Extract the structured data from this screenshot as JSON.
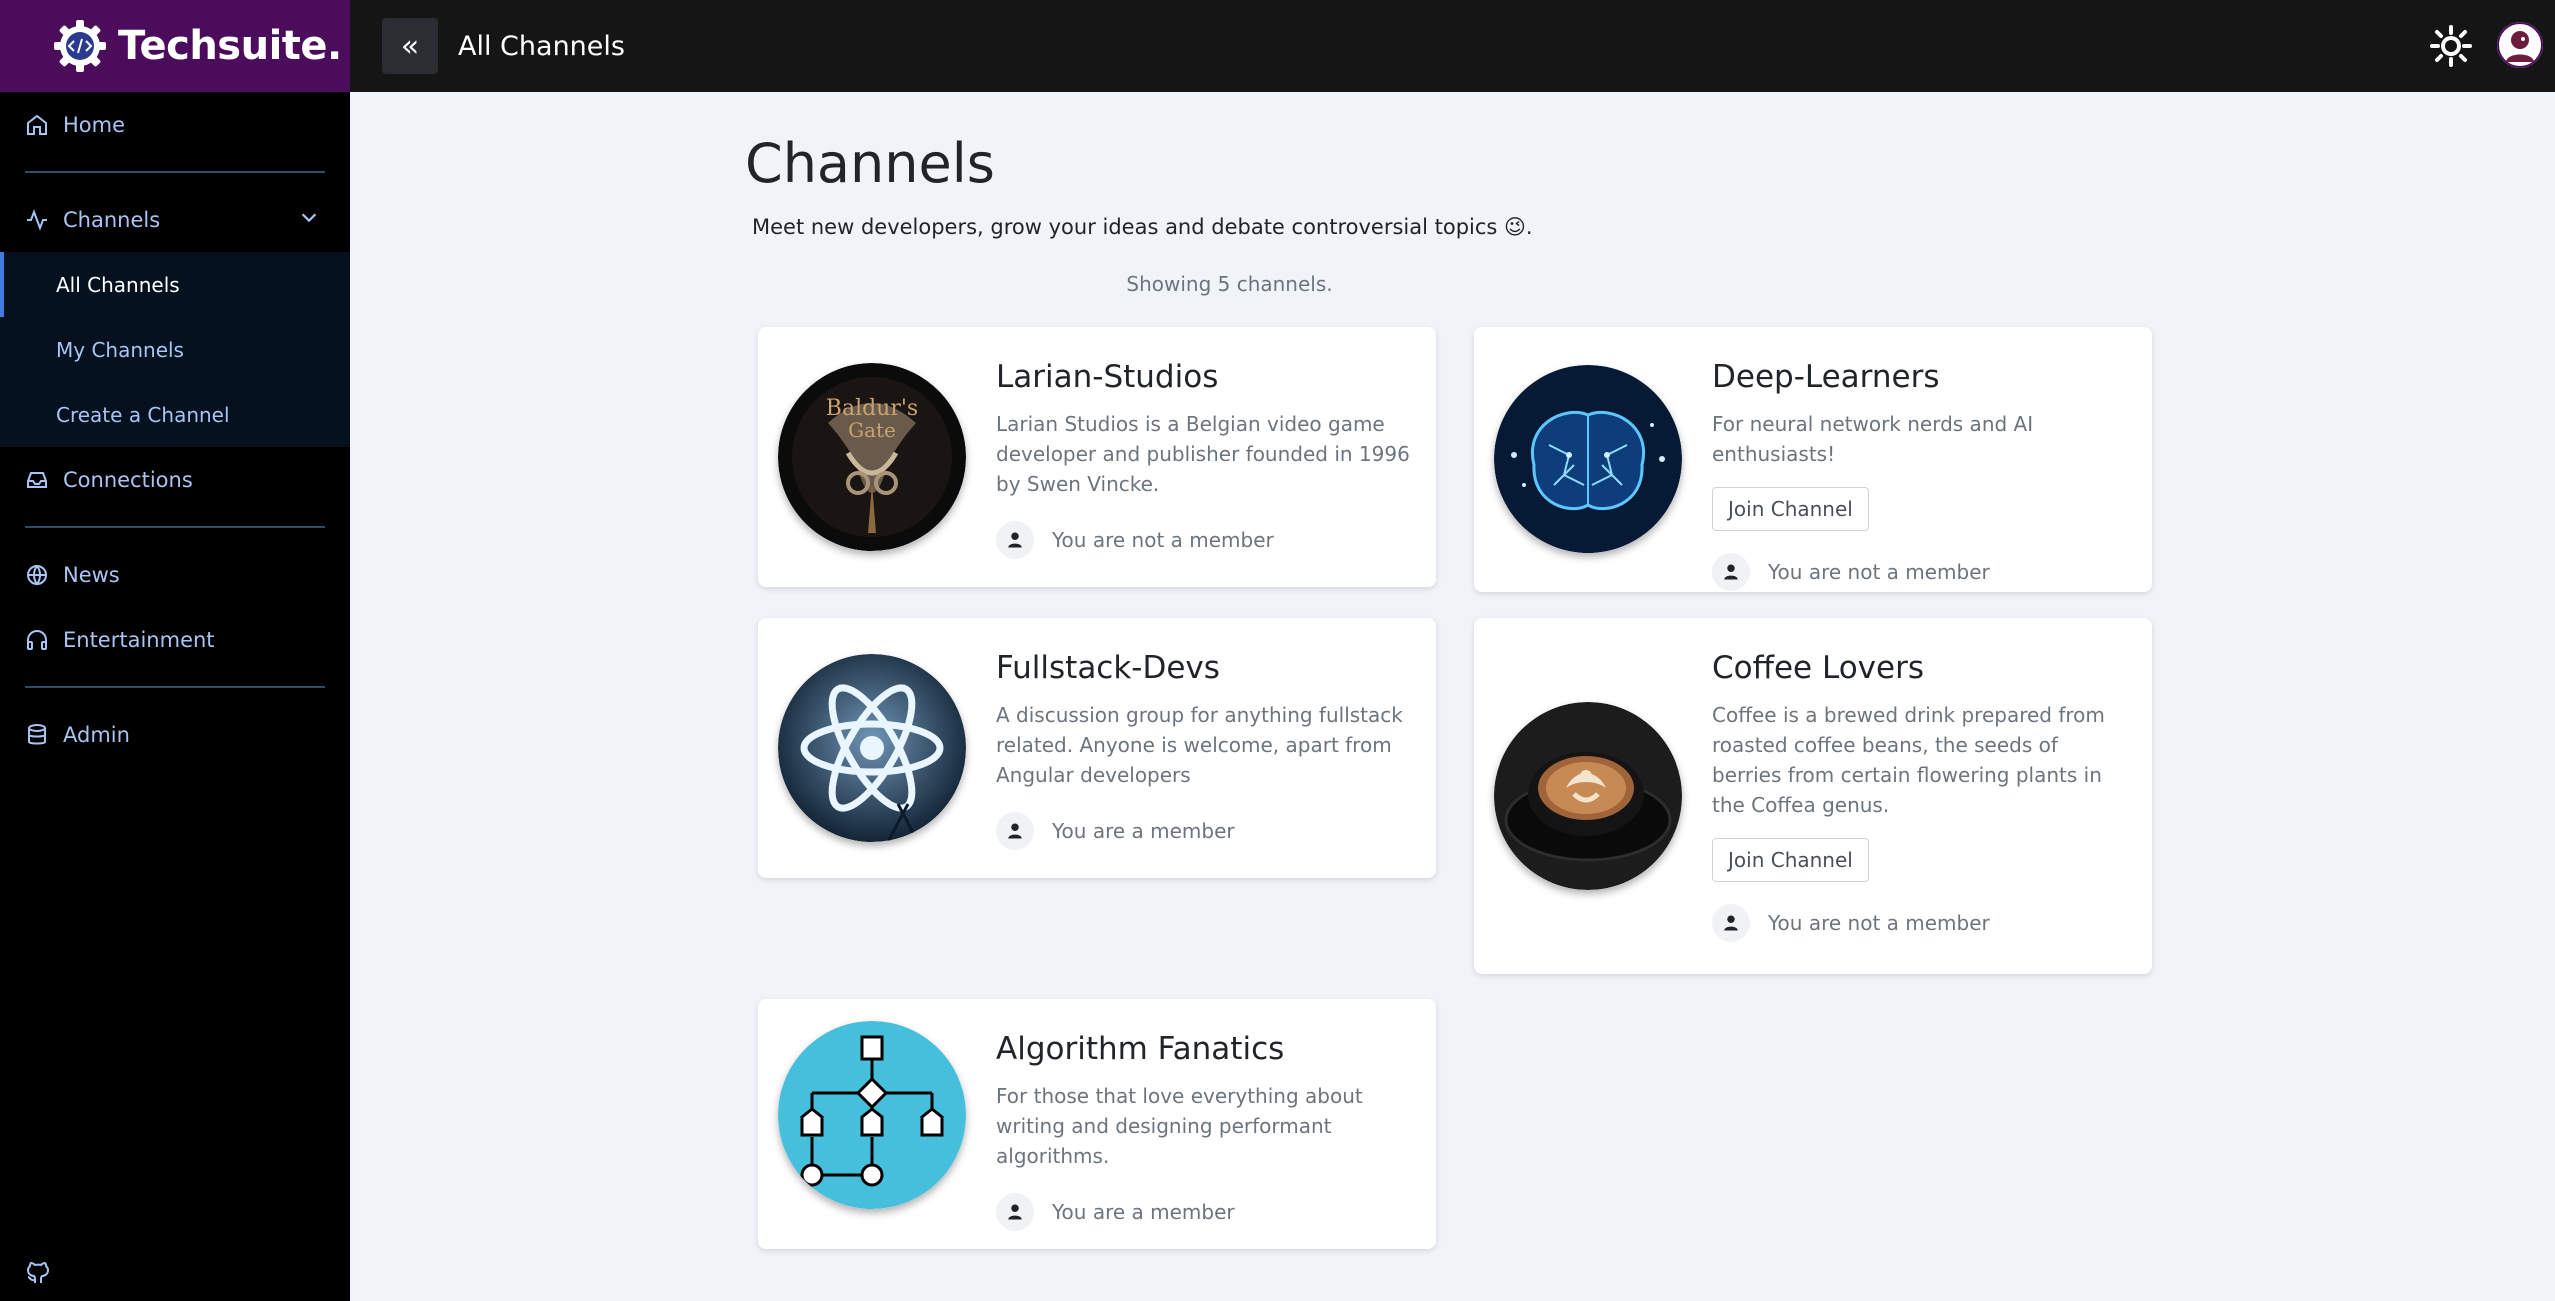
{
  "app": {
    "brand": "Techsuite.",
    "page_title_top": "All Channels"
  },
  "sidebar": {
    "items": [
      {
        "label": "Home",
        "icon": "home-icon"
      },
      {
        "label": "Channels",
        "icon": "activity-icon"
      },
      {
        "label": "Connections",
        "icon": "inbox-icon"
      },
      {
        "label": "News",
        "icon": "globe-icon"
      },
      {
        "label": "Entertainment",
        "icon": "headphones-icon"
      },
      {
        "label": "Admin",
        "icon": "database-icon"
      }
    ],
    "subitems": [
      {
        "label": "All Channels",
        "active": true
      },
      {
        "label": "My Channels",
        "active": false
      },
      {
        "label": "Create a Channel",
        "active": false
      }
    ],
    "footer_icon": "github-icon"
  },
  "main": {
    "title": "Channels",
    "description": "Meet new developers, grow your ideas and debate controversial topics 😉.",
    "count_text": "Showing 5 channels.",
    "join_label": "Join Channel",
    "channels": [
      {
        "name": "Larian-Studios",
        "description": "Larian Studios is a Belgian video game developer and publisher founded in 1996 by Swen Vincke.",
        "membership": "You are not a member",
        "show_join": false
      },
      {
        "name": "Deep-Learners",
        "description": "For neural network nerds and AI enthusiasts!",
        "membership": "You are not a member",
        "show_join": true
      },
      {
        "name": "Fullstack-Devs",
        "description": "A discussion group for anything fullstack related. Anyone is welcome, apart from Angular developers",
        "membership": "You are a member",
        "show_join": false
      },
      {
        "name": "Coffee Lovers",
        "description": "Coffee is a brewed drink prepared from roasted coffee beans, the seeds of berries from certain flowering plants in the Coffea genus.",
        "membership": "You are not a member",
        "show_join": true
      },
      {
        "name": "Algorithm Fanatics",
        "description": "For those that love everything about writing and designing performant algorithms.",
        "membership": "You are a member",
        "show_join": false
      }
    ]
  },
  "colors": {
    "brand_bg": "#4b0c5c",
    "sidebar_bg": "#000000",
    "topbar_bg": "#151515",
    "accent": "#3e7be0",
    "nav_text": "#a9c4f2"
  }
}
